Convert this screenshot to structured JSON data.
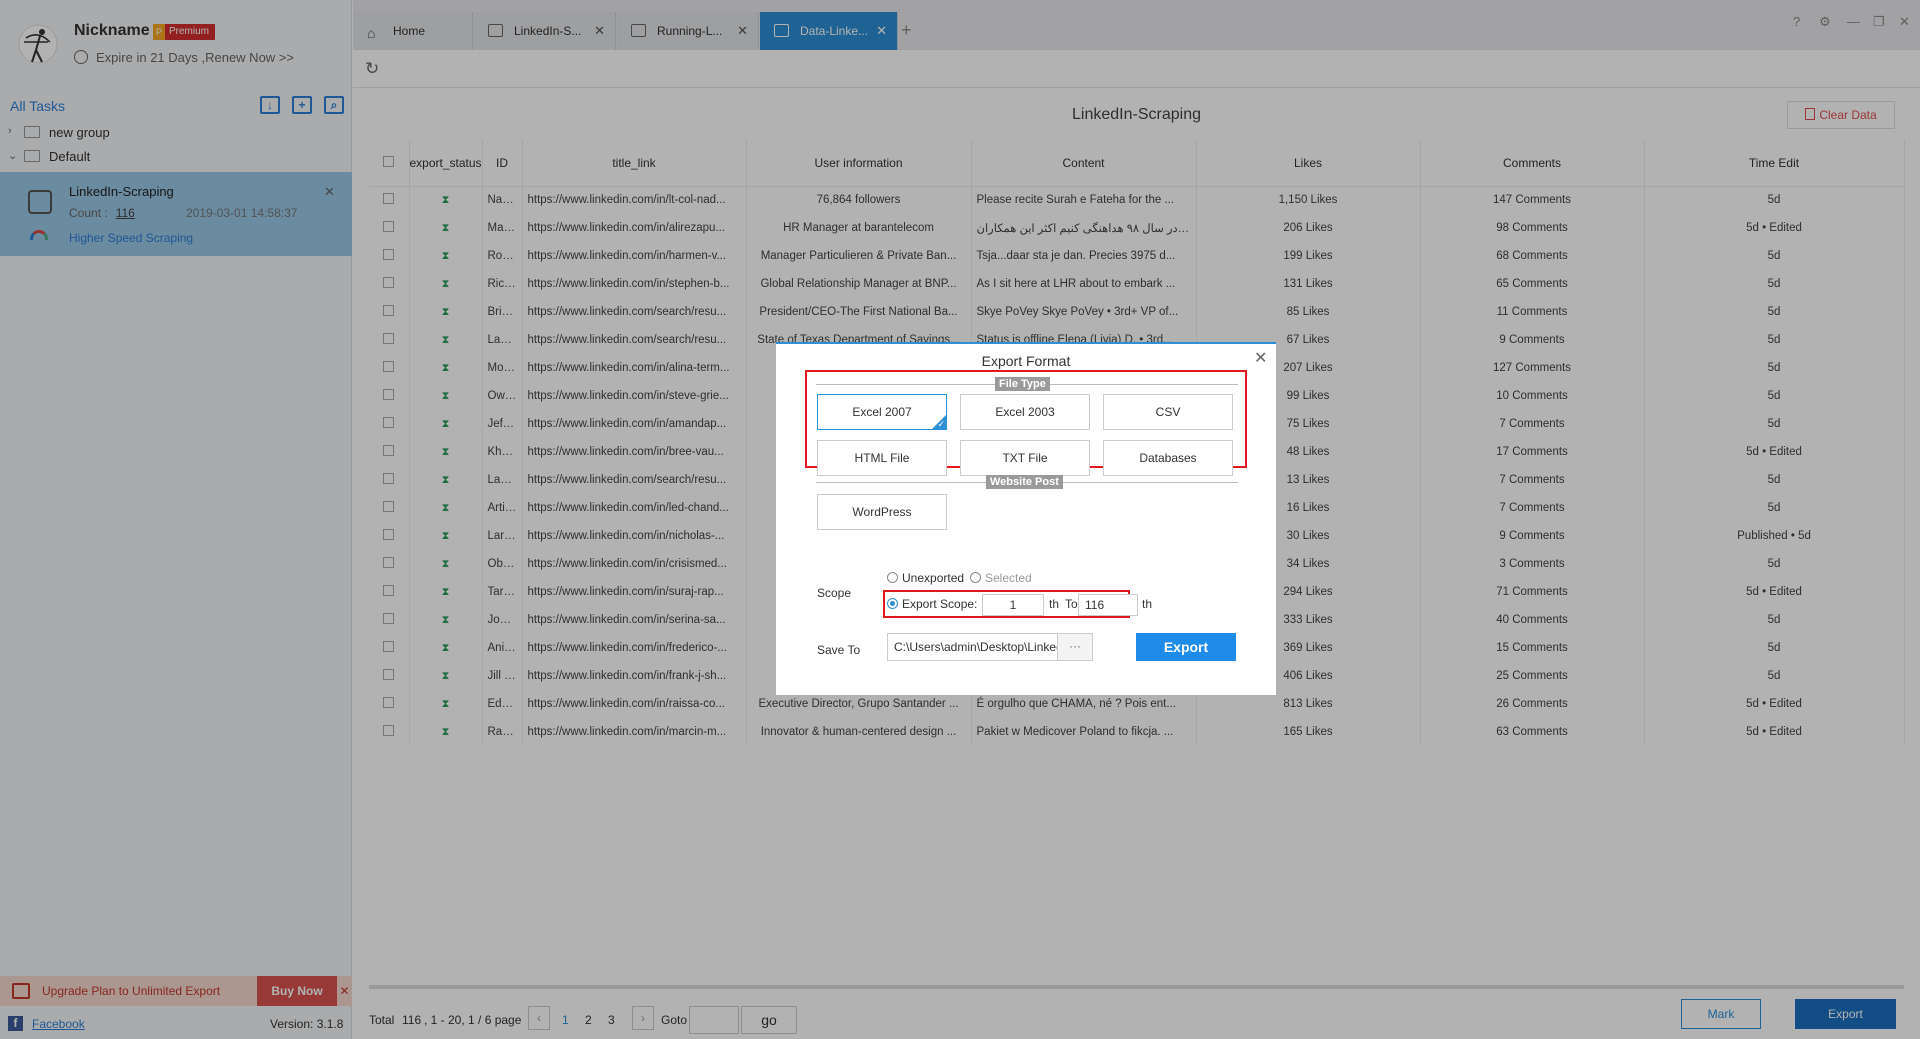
{
  "sidebar": {
    "nickname": "Nickname",
    "premium_badge": "Premium",
    "premium_icon": "P",
    "expire_text": "Expire in 21 Days ,Renew Now >>",
    "all_tasks": "All Tasks",
    "groups": [
      {
        "label": "new group"
      },
      {
        "label": "Default"
      }
    ],
    "task": {
      "name": "LinkedIn-Scraping",
      "count_label": "Count :",
      "count_value": "116",
      "date": "2019-03-01 14:58:37",
      "speed_label": "Higher Speed Scraping"
    },
    "upgrade_text": "Upgrade Plan to Unlimited Export",
    "buy_now": "Buy Now",
    "facebook": "Facebook",
    "version": "Version: 3.1.8"
  },
  "tabs": [
    {
      "label": "Home"
    },
    {
      "label": "LinkedIn-S..."
    },
    {
      "label": "Running-L..."
    },
    {
      "label": "Data-Linke..."
    }
  ],
  "main": {
    "page_title": "LinkedIn-Scraping",
    "clear_data": "Clear Data",
    "columns": [
      "export_status",
      "ID",
      "title_link",
      "User information",
      "Content",
      "Likes",
      "Comments",
      "Time Edit"
    ],
    "rows": [
      [
        "Natio...",
        "https://www.linkedin.com/in/lt-col-nad...",
        "76,864 followers",
        "Please recite Surah e Fateha for the ...",
        "1,150 Likes",
        "147 Comments",
        "5d"
      ],
      [
        "Mary...",
        "https://www.linkedin.com/in/alirezapu...",
        "HR Manager at barantelecom",
        "مکارانم در سال ۹۸ هداهنگی کنیم اکثر این همکاران...",
        "206 Likes",
        "98 Comments",
        "5d • Edited"
      ],
      [
        "Robe...",
        "https://www.linkedin.com/in/harmen-v...",
        "Manager Particulieren & Private Ban...",
        "Tsja...daar sta je dan. Precies 3975 d...",
        "199 Likes",
        "68 Comments",
        "5d"
      ],
      [
        "Rich...",
        "https://www.linkedin.com/in/stephen-b...",
        "Global Relationship Manager at BNP...",
        "As I sit here at LHR about to embark ...",
        "131 Likes",
        "65 Comments",
        "5d"
      ],
      [
        "Brian...",
        "https://www.linkedin.com/search/resu...",
        "President/CEO-The First National Ba...",
        "Skye PoVey Skye PoVey • 3rd+ VP of...",
        "85 Likes",
        "11 Comments",
        "5d"
      ],
      [
        "Land...",
        "https://www.linkedin.com/search/resu...",
        "State of Texas Department of Savings...",
        "Status is offline Elena (Livia) D. • 3rd...",
        "67 Likes",
        "9 Comments",
        "5d"
      ],
      [
        "Moni...",
        "https://www.linkedin.com/in/alina-term...",
        "",
        "",
        "207 Likes",
        "127 Comments",
        "5d"
      ],
      [
        "Owe...",
        "https://www.linkedin.com/in/steve-grie...",
        "",
        "",
        "99 Likes",
        "10 Comments",
        "5d"
      ],
      [
        "Jeff C...",
        "https://www.linkedin.com/in/amandap...",
        "",
        "",
        "75 Likes",
        "7 Comments",
        "5d"
      ],
      [
        "Khas...",
        "https://www.linkedin.com/in/bree-vau...",
        "",
        "",
        "48 Likes",
        "17 Comments",
        "5d • Edited"
      ],
      [
        "Lauri...",
        "https://www.linkedin.com/search/resu...",
        "",
        "",
        "13 Likes",
        "7 Comments",
        "5d"
      ],
      [
        "Artie ...",
        "https://www.linkedin.com/in/led-chand...",
        "",
        "",
        "16 Likes",
        "7 Comments",
        "5d"
      ],
      [
        "Larry...",
        "https://www.linkedin.com/in/nicholas-...",
        "",
        "",
        "30 Likes",
        "9 Comments",
        "Published • 5d"
      ],
      [
        "Obil ...",
        "https://www.linkedin.com/in/crisismed...",
        "",
        "",
        "34 Likes",
        "3 Comments",
        "5d"
      ],
      [
        "Tariq...",
        "https://www.linkedin.com/in/suraj-rap...",
        "",
        "",
        "294 Likes",
        "71 Comments",
        "5d • Edited"
      ],
      [
        "Josh...",
        "https://www.linkedin.com/in/serina-sa...",
        "",
        "",
        "333 Likes",
        "40 Comments",
        "5d"
      ],
      [
        "Anib...",
        "https://www.linkedin.com/in/frederico-...",
        "",
        "",
        "369 Likes",
        "15 Comments",
        "5d"
      ],
      [
        "Jill C...",
        "https://www.linkedin.com/in/frank-j-sh...",
        "",
        "",
        "406 Likes",
        "25 Comments",
        "5d"
      ],
      [
        "Ede ...",
        "https://www.linkedin.com/in/raissa-co...",
        "Executive Director, Grupo Santander ...",
        "É orgulho que CHAMA, né ? Pois ent...",
        "813 Likes",
        "26 Comments",
        "5d • Edited"
      ],
      [
        "Rafa...",
        "https://www.linkedin.com/in/marcin-m...",
        "Innovator & human-centered design ...",
        "Pakiet w Medicover Poland to fikcja. ...",
        "165 Likes",
        "63 Comments",
        "5d • Edited"
      ]
    ],
    "pager": {
      "total_label": "Total",
      "total": "116",
      "range": ", 1 - 20, 1 / 6 page",
      "pages": [
        "1",
        "2",
        "3"
      ],
      "goto": "Goto",
      "go": "go"
    },
    "mark": "Mark",
    "export": "Export"
  },
  "modal": {
    "title": "Export Format",
    "file_type_label": "File Type",
    "file_types": [
      "Excel 2007",
      "Excel 2003",
      "CSV",
      "HTML File",
      "TXT File",
      "Databases"
    ],
    "website_post_label": "Website Post",
    "wordpress": "WordPress",
    "scope_label": "Scope",
    "unexported": "Unexported",
    "selected": "Selected",
    "export_scope": "Export Scope:",
    "scope_from": "1",
    "th1": "th",
    "to": "To",
    "scope_to": "116",
    "th2": "th",
    "save_to_label": "Save To",
    "save_path": "C:\\Users\\admin\\Desktop\\LinkedIn-S",
    "browse": "···",
    "export_button": "Export"
  },
  "colors": {
    "accent": "#2d8fd5",
    "highlight_red": "#e0191e",
    "task_selected": "#99c7e6",
    "status_green": "#2a9d5a"
  }
}
